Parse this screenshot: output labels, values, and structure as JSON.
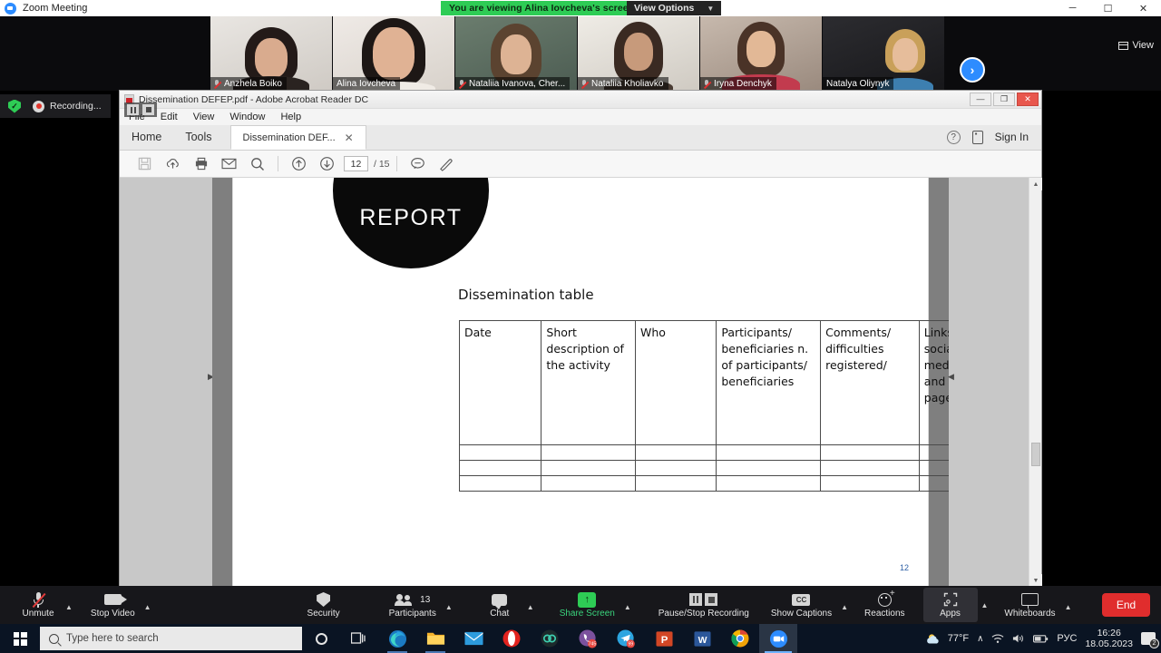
{
  "zoom_window": {
    "title": "Zoom Meeting",
    "sharing_banner": "You are viewing Alina Iovcheva's screen",
    "view_options_label": "View Options",
    "view_button_label": "View",
    "window_controls": {
      "minimize": "─",
      "maximize": "☐",
      "close": "✕"
    },
    "next_page_arrow": "›",
    "participants": [
      {
        "name": "Anzhela Boiko",
        "muted": true,
        "speaking": false
      },
      {
        "name": "Alina Iovcheva",
        "muted": false,
        "speaking": true
      },
      {
        "name": "Nataliia Ivanova, Cher...",
        "muted": true,
        "speaking": false
      },
      {
        "name": "Nataliia Kholiavko",
        "muted": true,
        "speaking": false
      },
      {
        "name": "Iryna Denchyk",
        "muted": true,
        "speaking": false
      },
      {
        "name": "Natalya Oliynyk",
        "muted": false,
        "speaking": false
      }
    ]
  },
  "recording_control": {
    "shield_label": "✓",
    "status_label": "Recording...",
    "pause_icon": "pause-icon",
    "stop_icon": "stop-icon"
  },
  "acrobat": {
    "window_title": "Dissemination DEFEP.pdf - Adobe Acrobat Reader DC",
    "window_controls": {
      "minimize": "—",
      "restore": "❐",
      "close": "✕"
    },
    "menu": [
      "File",
      "Edit",
      "View",
      "Window",
      "Help"
    ],
    "tabs": {
      "home": "Home",
      "tools": "Tools",
      "document": "Dissemination DEF...",
      "close_glyph": "✕"
    },
    "sign_in": "Sign In",
    "toolbar": {
      "save": "save-icon",
      "upload": "upload-cloud-icon",
      "print": "print-icon",
      "email": "email-icon",
      "search": "search-icon",
      "prev_page": "↑",
      "next_page": "↓",
      "page_value": "12",
      "page_total": "/ 15",
      "comment": "comment-icon",
      "highlight": "highlight-icon"
    },
    "document": {
      "badge_text": "REPORT",
      "heading": "Dissemination table",
      "page_label": "12",
      "table": {
        "headers": [
          "Date",
          "Short description of the activity",
          "Who",
          "Participants/ beneficiaries n. of participants/ beneficiaries",
          "Comments/ difficulties registered/",
          "Links for social media and web-pages"
        ],
        "empty_rows": 3
      }
    }
  },
  "zoom_toolbar": {
    "items": [
      {
        "label": "Unmute",
        "icon": "mic-muted-icon",
        "caret": true,
        "highlight": false
      },
      {
        "label": "Stop Video",
        "icon": "camera-icon",
        "caret": true,
        "highlight": false
      },
      {
        "label": "Security",
        "icon": "shield-icon",
        "caret": false,
        "highlight": false
      },
      {
        "label": "Participants",
        "icon": "participants-icon",
        "caret": true,
        "highlight": false,
        "count": "13"
      },
      {
        "label": "Chat",
        "icon": "chat-icon",
        "caret": true,
        "highlight": false
      },
      {
        "label": "Share Screen",
        "icon": "share-screen-icon",
        "caret": true,
        "highlight": false,
        "green": true
      },
      {
        "label": "Pause/Stop Recording",
        "icon": "pause-stop-recording-icon",
        "caret": false,
        "highlight": false
      },
      {
        "label": "Show Captions",
        "icon": "closed-caption-icon",
        "caret": true,
        "highlight": false
      },
      {
        "label": "Reactions",
        "icon": "reactions-icon",
        "caret": false,
        "highlight": false
      },
      {
        "label": "Apps",
        "icon": "apps-icon",
        "caret": true,
        "highlight": true
      },
      {
        "label": "Whiteboards",
        "icon": "whiteboard-icon",
        "caret": true,
        "highlight": false
      }
    ],
    "end_button": "End"
  },
  "taskbar": {
    "start_icon": "windows-logo-icon",
    "search_placeholder": "Type here to search",
    "cortana_icon": "cortana-circle-icon",
    "task_view_icon": "task-view-icon",
    "apps": [
      {
        "name": "edge-icon",
        "badge": ""
      },
      {
        "name": "file-explorer-icon",
        "badge": ""
      },
      {
        "name": "mail-icon",
        "badge": ""
      },
      {
        "name": "opera-icon",
        "badge": ""
      },
      {
        "name": "viber-icon",
        "badge": ""
      },
      {
        "name": "viber-messages-icon",
        "badge": "745"
      },
      {
        "name": "telegram-icon",
        "badge": "99"
      },
      {
        "name": "powerpoint-icon",
        "badge": ""
      },
      {
        "name": "word-icon",
        "badge": ""
      },
      {
        "name": "chrome-icon",
        "badge": ""
      },
      {
        "name": "zoom-icon",
        "badge": ""
      }
    ],
    "tray": {
      "weather_temp": "77°F",
      "show_hidden": "∧",
      "wifi_icon": "wifi-icon",
      "volume_icon": "volume-icon",
      "battery_icon": "battery-icon",
      "language": "РУС",
      "time": "16:26",
      "date": "18.05.2023",
      "notifications_badge": "2"
    }
  }
}
